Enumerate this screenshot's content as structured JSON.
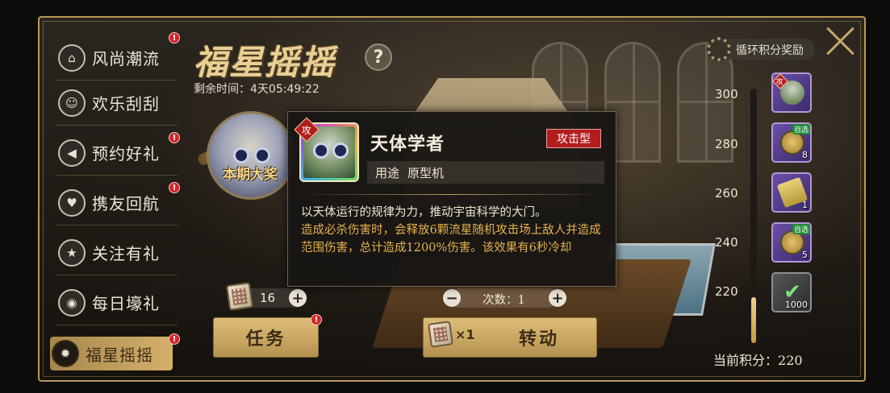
{
  "sidebar": {
    "items": [
      {
        "label": "风尚潮流",
        "icon": "hanger-icon",
        "glyph": "⌂",
        "badge": "!"
      },
      {
        "label": "欢乐刮刮",
        "icon": "mask-icon",
        "glyph": "☺",
        "badge": ""
      },
      {
        "label": "预约好礼",
        "icon": "megaphone-icon",
        "glyph": "◀",
        "badge": "!"
      },
      {
        "label": "携友回航",
        "icon": "thumbs-up-icon",
        "glyph": "♥",
        "badge": "!"
      },
      {
        "label": "关注有礼",
        "icon": "star-icon",
        "glyph": "★",
        "badge": ""
      },
      {
        "label": "每日壕礼",
        "icon": "cat-icon",
        "glyph": "◉",
        "badge": ""
      },
      {
        "label": "福星摇摇",
        "icon": "gear-icon",
        "glyph": "✹",
        "badge": "!"
      }
    ]
  },
  "header": {
    "title": "福星摇摇",
    "help_glyph": "?",
    "time_label": "剩余时间：",
    "time_value": "4天05:49:22"
  },
  "featured": {
    "tag": "本期大奖"
  },
  "tooltip": {
    "badge": "攻",
    "name": "天体学者",
    "type": "攻击型",
    "usage_label": "用途",
    "usage_value": "原型机",
    "description": "以天体运行的规律为力，推动宇宙科学的大门。",
    "effect": "造成必杀伤害时，会释放6颗流星随机攻击场上敌人并造成范围伤害，总计造成1200%伤害。该效果有6秒冷却"
  },
  "controls": {
    "ticket_count": "16",
    "plus": "+",
    "minus": "−",
    "times_label": "次数：",
    "times_value": "1",
    "task_button": "任务",
    "spin_button": "转动",
    "spin_cost": "×1"
  },
  "rewards": {
    "cycle_label": "循环积分奖励",
    "ticks": [
      "300",
      "280",
      "260",
      "240",
      "220"
    ],
    "progress_fraction": 0.18,
    "items": [
      {
        "name": "reward-avatar",
        "badge": "攻",
        "qty": "",
        "pick": ""
      },
      {
        "name": "reward-coin-box",
        "badge": "",
        "qty": "8",
        "pick": "自选"
      },
      {
        "name": "reward-scroll",
        "badge": "",
        "qty": "1",
        "pick": ""
      },
      {
        "name": "reward-coin-box-2",
        "badge": "",
        "qty": "5",
        "pick": "自选"
      },
      {
        "name": "reward-claimed",
        "badge": "",
        "qty": "1000",
        "pick": ""
      }
    ],
    "score_label": "当前积分：",
    "score_value": "220"
  },
  "colors": {
    "accent_gold": "#c7a460",
    "warning_red": "#b21e1e",
    "effect_orange": "#e6b24a"
  }
}
